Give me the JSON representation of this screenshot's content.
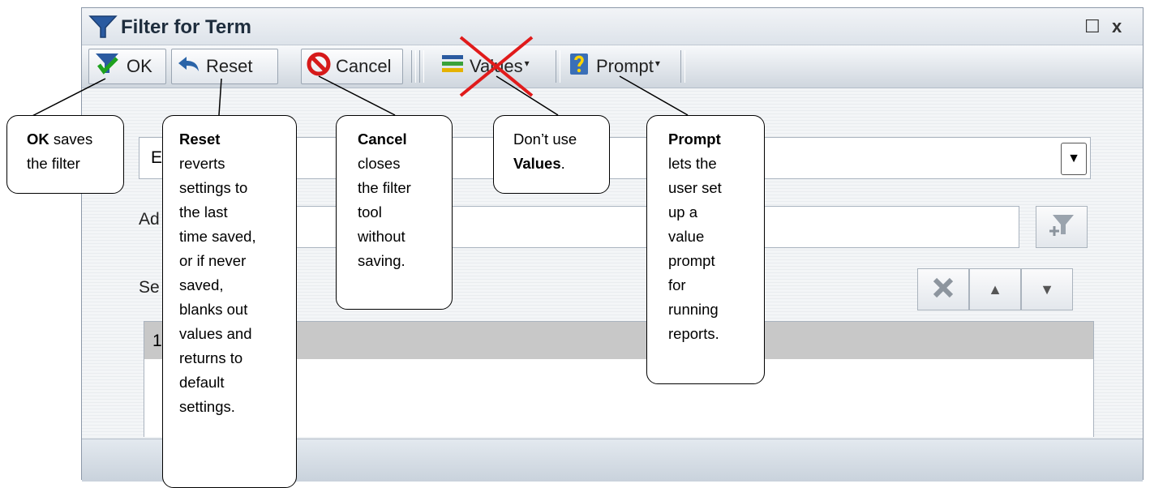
{
  "window": {
    "title": "Filter for Term",
    "maximize_glyph": "☐",
    "close_glyph": "x"
  },
  "toolbar": {
    "ok_label": "OK",
    "reset_label": "Reset",
    "cancel_label": "Cancel",
    "values_label": "Values",
    "prompt_label": "Prompt",
    "caret_glyph": "▾"
  },
  "panel": {
    "field1_partial_text": "E",
    "label2_partial": "Ad",
    "label3_partial": "Se",
    "row1_partial": "1",
    "dropdown_glyph": "▼",
    "up_glyph": "▲",
    "down_glyph": "▼"
  },
  "callouts": {
    "ok": {
      "bold": "OK",
      "rest1": " saves",
      "rest2": "the filter"
    },
    "reset": {
      "bold": "Reset",
      "lines": [
        "reverts",
        "settings to",
        "the last",
        "time saved,",
        "or if never",
        "saved,",
        "blanks out",
        "values and",
        "returns to",
        "default",
        "settings."
      ]
    },
    "cancel": {
      "bold": "Cancel",
      "lines": [
        "closes",
        "the filter",
        "tool",
        "without",
        "saving."
      ]
    },
    "values": {
      "line1": "Don’t use",
      "bold": "Values",
      "tail": "."
    },
    "prompt": {
      "bold": "Prompt",
      "lines": [
        "lets the",
        "user set",
        "up a",
        "value",
        "prompt",
        "for",
        "running",
        "reports."
      ]
    }
  },
  "colors": {
    "accent": "#2a64a8",
    "cross": "#e01b1b"
  }
}
